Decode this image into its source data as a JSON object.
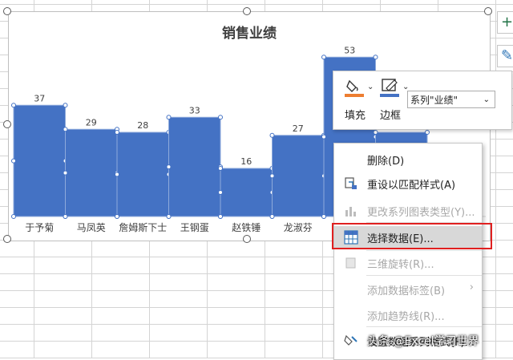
{
  "chart_data": {
    "type": "bar",
    "title": "销售业绩",
    "categories": [
      "于予菊",
      "马凤英",
      "詹姆斯下士",
      "王钢蛋",
      "赵铁锤",
      "龙淑芬",
      "",
      ""
    ],
    "series": [
      {
        "name": "业绩",
        "values": [
          37,
          29,
          28,
          33,
          16,
          27,
          53,
          28
        ]
      }
    ],
    "ylim": [
      0,
      60
    ],
    "bar_color": "#4472c4",
    "grid": false
  },
  "format_bar": {
    "fill_label": "填充",
    "border_label": "边框",
    "series_select": "系列\"业绩\""
  },
  "context_menu": {
    "items": [
      {
        "label": "删除(D)",
        "icon": "none",
        "disabled": false
      },
      {
        "label": "重设以匹配样式(A)",
        "icon": "reset-style-icon",
        "disabled": false
      },
      {
        "label": "更改系列图表类型(Y)...",
        "icon": "chart-type-icon",
        "disabled": true
      },
      {
        "label": "选择数据(E)...",
        "icon": "select-data-icon",
        "disabled": false,
        "highlighted": true
      },
      {
        "label": "三维旋转(R)...",
        "icon": "rotate-3d-icon",
        "disabled": true
      },
      {
        "label": "添加数据标签(B)",
        "icon": "none",
        "disabled": true
      },
      {
        "label": "添加趋势线(R)...",
        "icon": "none",
        "disabled": true
      },
      {
        "label": "设置数据系列格式(F)...",
        "icon": "format-icon",
        "disabled": false
      }
    ]
  },
  "watermark": "头条 @Excel学习世界",
  "colors": {
    "accent": "#4472c4",
    "highlight_box": "#e02020",
    "fill_bar": "#ed7d31"
  }
}
